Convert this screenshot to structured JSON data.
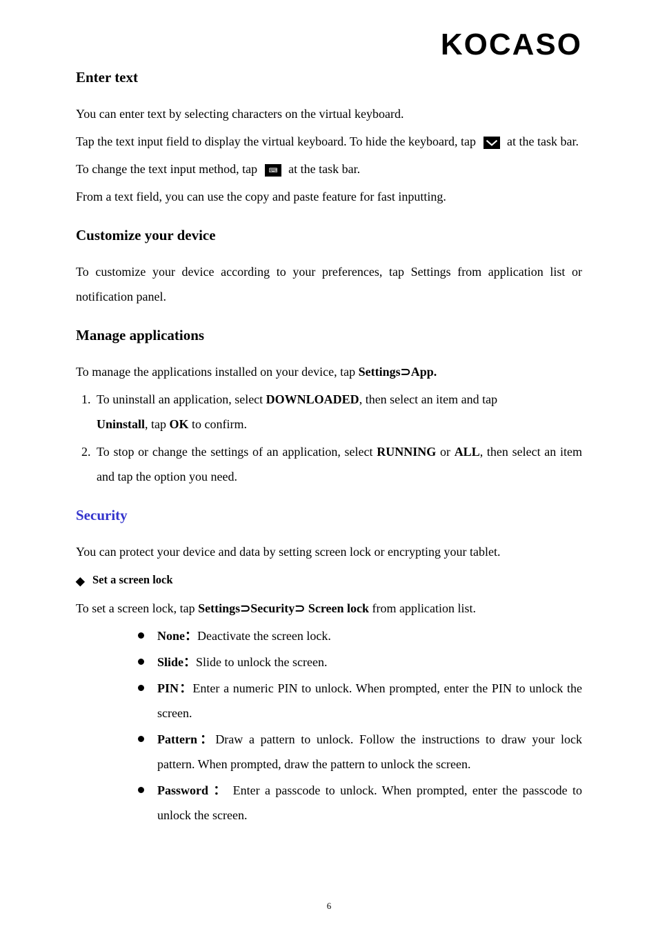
{
  "brand": "KOCASO",
  "sections": {
    "enter_text": {
      "title": "Enter text",
      "p1_a": "You can enter text by selecting characters on the virtual keyboard.",
      "p2_a": "Tap the text input field to display the virtual keyboard. To hide the keyboard, tap ",
      "p2_b": " at the task bar.",
      "p3_a": "To change the text input method, tap ",
      "p3_b": " at the task bar.",
      "p4": "From a text field, you can use the copy and paste feature for fast inputting."
    },
    "customize": {
      "title": "Customize your device",
      "p1": "To customize your device according to your preferences, tap Settings from application list or notification panel."
    },
    "manage": {
      "title": "Manage applications",
      "intro_a": "To manage the applications installed on your device, tap ",
      "intro_b": "Settings",
      "intro_c": "App.",
      "li1_a": "To uninstall an application, select ",
      "li1_b": "DOWNLOADED",
      "li1_c": ", then select an item and tap ",
      "li1_d": "Uninstall",
      "li1_e": ", tap ",
      "li1_f": "OK",
      "li1_g": " to confirm.",
      "li2_a": "To stop or change the settings of an application, select ",
      "li2_b": "RUNNING",
      "li2_c": " or ",
      "li2_d": "ALL",
      "li2_e": ", then select an item and tap the option you need."
    },
    "security": {
      "title": "Security",
      "intro": "You can protect your device and data by setting screen lock or encrypting your tablet.",
      "sub1": "Set a screen lock",
      "sub1_intro_a": "To set a screen lock, tap ",
      "sub1_intro_b": "Settings",
      "sub1_intro_c": "Security",
      "sub1_intro_d": " Screen lock",
      "sub1_intro_e": " from application list.",
      "opts": {
        "none": {
          "k": "None",
          "sep": "：",
          "v": "Deactivate the screen lock."
        },
        "slide": {
          "k": "Slide",
          "sep": "：",
          "v": "Slide to unlock the screen."
        },
        "pin": {
          "k": "PIN",
          "sep": "：",
          "v": "Enter a numeric PIN to unlock. When prompted, enter the PIN to unlock the screen."
        },
        "pattern": {
          "k": "Pattern",
          "sep": "：",
          "v": "Draw a pattern to unlock. Follow the instructions to draw your lock pattern. When prompted, draw the pattern to unlock the screen."
        },
        "password": {
          "k": "Password",
          "sep": " ：",
          "v": " Enter a passcode to unlock. When prompted, enter the passcode to unlock the screen."
        }
      }
    }
  },
  "glyphs": {
    "superset": "⊃",
    "diamond": "◆"
  },
  "page_number": "6"
}
